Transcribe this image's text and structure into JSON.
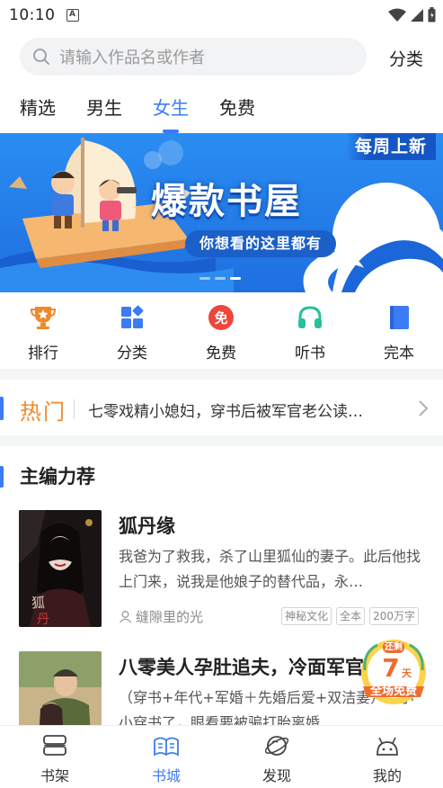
{
  "status_bar": {
    "time": "10:10",
    "notification_icon": "A"
  },
  "search": {
    "placeholder": "请输入作品名或作者",
    "category_label": "分类"
  },
  "tabs": [
    {
      "label": "精选",
      "active": false
    },
    {
      "label": "男生",
      "active": false
    },
    {
      "label": "女生",
      "active": true
    },
    {
      "label": "免费",
      "active": false
    }
  ],
  "banner": {
    "title": "爆款书屋",
    "subtitle": "你想看的这里都有",
    "corner_label": "每周上新",
    "slide_count": 3,
    "active_slide": 3
  },
  "quick_nav": [
    {
      "label": "排行",
      "icon": "trophy-icon",
      "color": "#f0892c"
    },
    {
      "label": "分类",
      "icon": "category-icon",
      "color": "#3b7cf5"
    },
    {
      "label": "免费",
      "icon": "free-icon",
      "color": "#f0453a"
    },
    {
      "label": "听书",
      "icon": "headphones-icon",
      "color": "#25c19a"
    },
    {
      "label": "完本",
      "icon": "book-icon",
      "color": "#3b7cf5"
    }
  ],
  "hot": {
    "label": "热门",
    "text": "七零戏精小媳妇，穿书后被军官老公读…"
  },
  "section": {
    "title": "主编力荐"
  },
  "books": [
    {
      "title": "狐丹缘",
      "description": "我爸为了救我，杀了山里狐仙的妻子。此后他找上门来，说我是他娘子的替代品，永…",
      "author": "缝隙里的光",
      "tags": [
        "神秘文化",
        "全本",
        "200万字"
      ]
    },
    {
      "title": "八零美人孕肚追夫，冷面军官",
      "description": "（穿书+年代+军婚＋先婚后爱+双洁妻）乔小小穿书了，眼看要被骗打胎离婚",
      "author": "",
      "tags": []
    }
  ],
  "promo": {
    "top_label": "还剩",
    "days": "7",
    "unit": "天",
    "bottom_label": "全场免费"
  },
  "bottom_nav": [
    {
      "label": "书架",
      "icon": "bookshelf-icon",
      "active": false
    },
    {
      "label": "书城",
      "icon": "bookstore-icon",
      "active": true
    },
    {
      "label": "发现",
      "icon": "planet-icon",
      "active": false
    },
    {
      "label": "我的",
      "icon": "profile-icon",
      "active": false
    }
  ],
  "colors": {
    "accent": "#3b7cf5",
    "hot": "#f08a2c",
    "promo": "#f6b52b"
  }
}
